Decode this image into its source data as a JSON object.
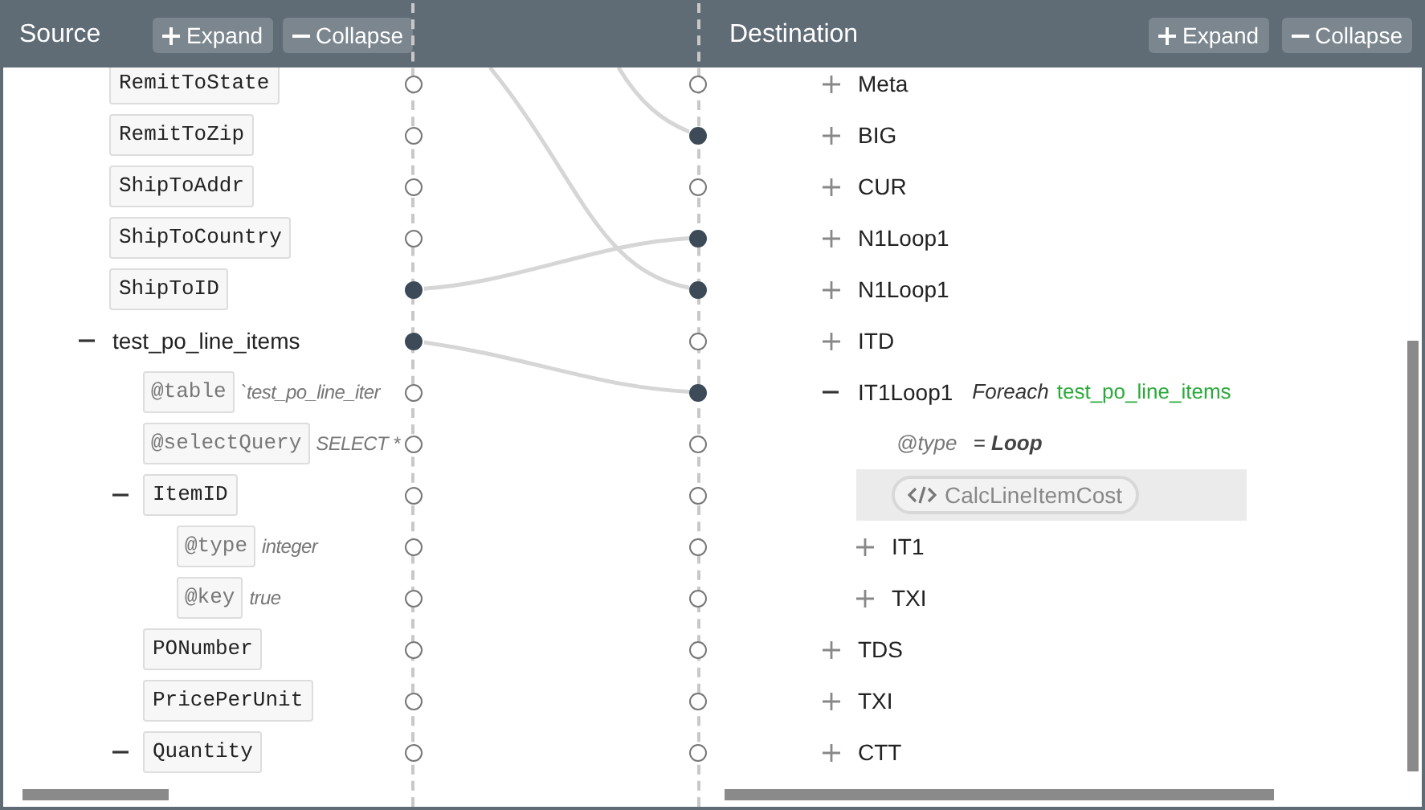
{
  "source": {
    "title": "Source",
    "buttons": [
      {
        "kind": "expand",
        "label": "Expand"
      },
      {
        "kind": "collapse",
        "label": "Collapse"
      }
    ],
    "items": [
      {
        "kind": "field",
        "label": "RemitToState",
        "mapped": false
      },
      {
        "kind": "field",
        "label": "RemitToZip",
        "mapped": false
      },
      {
        "kind": "field",
        "label": "ShipToAddr",
        "mapped": false
      },
      {
        "kind": "field",
        "label": "ShipToCountry",
        "mapped": false
      },
      {
        "kind": "field",
        "label": "ShipToID",
        "mapped": true
      },
      {
        "kind": "group",
        "label": "test_po_line_items",
        "mapped": true,
        "expanded": true,
        "children": [
          {
            "kind": "attr",
            "label": "@table",
            "value": "`test_po_line_iter",
            "mapped": false
          },
          {
            "kind": "attr",
            "label": "@selectQuery",
            "value": "SELECT *",
            "mapped": false
          },
          {
            "kind": "field",
            "label": "ItemID",
            "mapped": false,
            "expanded": true,
            "children": [
              {
                "kind": "attr",
                "label": "@type",
                "value": "integer",
                "mapped": false
              },
              {
                "kind": "attr",
                "label": "@key",
                "value": "true",
                "mapped": false
              }
            ]
          },
          {
            "kind": "field",
            "label": "PONumber",
            "mapped": false
          },
          {
            "kind": "field",
            "label": "PricePerUnit",
            "mapped": false
          },
          {
            "kind": "field",
            "label": "Quantity",
            "mapped": false,
            "expanded": true
          }
        ]
      }
    ]
  },
  "destination": {
    "title": "Destination",
    "buttons": [
      {
        "kind": "expand",
        "label": "Expand"
      },
      {
        "kind": "collapse",
        "label": "Collapse"
      }
    ],
    "items": [
      {
        "kind": "node",
        "label": "Meta",
        "mapped": false,
        "expanded": false
      },
      {
        "kind": "node",
        "label": "BIG",
        "mapped": true,
        "expanded": false
      },
      {
        "kind": "node",
        "label": "CUR",
        "mapped": false,
        "expanded": false
      },
      {
        "kind": "node",
        "label": "N1Loop1",
        "mapped": true,
        "expanded": false
      },
      {
        "kind": "node",
        "label": "N1Loop1",
        "mapped": true,
        "expanded": false
      },
      {
        "kind": "node",
        "label": "ITD",
        "mapped": false,
        "expanded": false
      },
      {
        "kind": "node",
        "label": "IT1Loop1",
        "mapped": true,
        "expanded": true,
        "foreach": "Foreach",
        "foreach_source": "test_po_line_items",
        "children": [
          {
            "kind": "attr",
            "label": "@type",
            "value": "= **Loop**",
            "mapped": false
          },
          {
            "kind": "code",
            "label": "CalcLineItemCost",
            "mapped": false,
            "selected": true
          },
          {
            "kind": "node",
            "label": "IT1",
            "mapped": false,
            "expanded": false
          },
          {
            "kind": "node",
            "label": "TXI",
            "mapped": false,
            "expanded": false
          }
        ]
      },
      {
        "kind": "node",
        "label": "TDS",
        "mapped": false,
        "expanded": false
      },
      {
        "kind": "node",
        "label": "TXI",
        "mapped": false,
        "expanded": false
      },
      {
        "kind": "node",
        "label": "CTT",
        "mapped": false,
        "expanded": false
      }
    ]
  }
}
